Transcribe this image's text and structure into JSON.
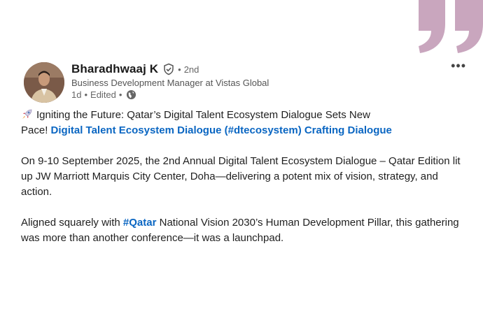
{
  "author": {
    "name": "Bharadhwaaj K",
    "degree": "2nd",
    "headline": "Business Development Manager at Vistas Global",
    "time": "1d",
    "edited": "Edited"
  },
  "post": {
    "title_line_a": "Igniting the Future: Qatar’s Digital Talent Ecosystem Dialogue Sets New",
    "title_line_b_prefix": "Pace! ",
    "title_link": "Digital Talent Ecosystem Dialogue (#dtecosystem) Crafting Dialogue",
    "para2": "On 9-10 September 2025, the 2nd Annual Digital Talent Ecosystem Dialogue – Qatar Edition lit up JW Marriott Marquis City Center, Doha—delivering a potent mix of vision, strategy, and action.",
    "para3_prefix": "Aligned squarely with ",
    "para3_hashtag": "#Qatar",
    "para3_suffix": " National Vision 2030’s Human Development Pillar, this gathering was more than another conference—it was a launchpad."
  },
  "ui": {
    "more_label": "•••",
    "separator": "•"
  },
  "colors": {
    "link": "#0a66c2",
    "quote_mark": "#c9a6be"
  }
}
